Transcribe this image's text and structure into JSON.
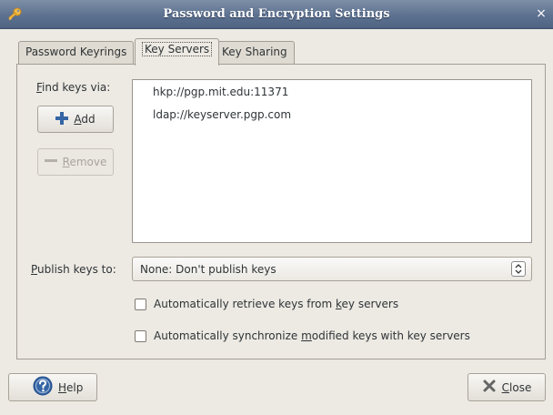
{
  "window": {
    "title": "Password and Encryption Settings",
    "close_glyph": "×"
  },
  "tabs": [
    {
      "label": "Password Keyrings",
      "active": false
    },
    {
      "label": "Key Servers",
      "active": true
    },
    {
      "label": "Key Sharing",
      "active": false
    }
  ],
  "key_servers": {
    "find_label_mnemonic": "F",
    "find_label_rest": "ind keys via:",
    "add_button_mnemonic": "A",
    "add_button_rest": "dd",
    "remove_button_mnemonic": "R",
    "remove_button_rest": "emove",
    "servers": [
      "hkp://pgp.mit.edu:11371",
      "ldap://keyserver.pgp.com"
    ],
    "publish_label_mnemonic": "P",
    "publish_label_rest": "ublish keys to:",
    "publish_selected": "None: Don't publish keys",
    "auto_retrieve_pre": "Automatically retrieve keys from ",
    "auto_retrieve_mnemonic": "k",
    "auto_retrieve_post": "ey servers",
    "auto_retrieve_checked": false,
    "auto_sync_pre": "Automatically synchronize ",
    "auto_sync_mnemonic": "m",
    "auto_sync_post": "odified keys with key servers",
    "auto_sync_checked": false
  },
  "footer": {
    "help_mnemonic": "H",
    "help_rest": "elp",
    "close_mnemonic": "C",
    "close_rest": "lose"
  },
  "icons": {
    "app": "key-icon",
    "add": "plus-icon",
    "remove": "minus-icon",
    "help": "help-icon",
    "close": "close-icon",
    "combo_arrows": "updown-arrows-icon"
  },
  "colors": {
    "titlebar": "#5d7190",
    "window_bg": "#ede9e3",
    "add_icon": "#3465a4",
    "help_icon": "#3465a4"
  }
}
